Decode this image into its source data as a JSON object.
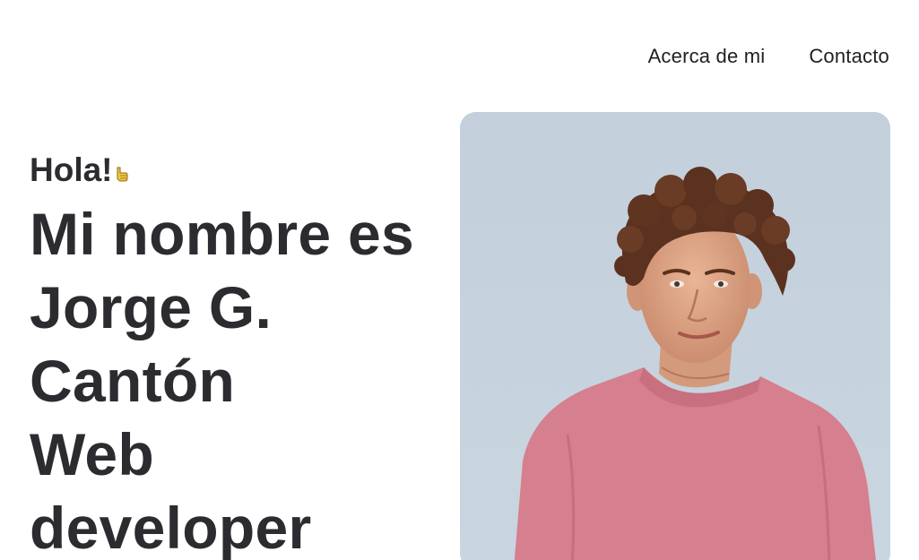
{
  "nav": {
    "items": [
      {
        "label": "Acerca de mi"
      },
      {
        "label": "Contacto"
      }
    ]
  },
  "hero": {
    "greeting": "Hola!",
    "greeting_icon": "pointing-hand-icon",
    "headline_lines": [
      "Mi nombre es",
      "Jorge G.",
      "Cantón",
      "Web",
      "developer"
    ]
  },
  "photo": {
    "icon": "portrait-photo",
    "background_color": "#c5d2dd",
    "shirt_color": "#d67f8e"
  }
}
